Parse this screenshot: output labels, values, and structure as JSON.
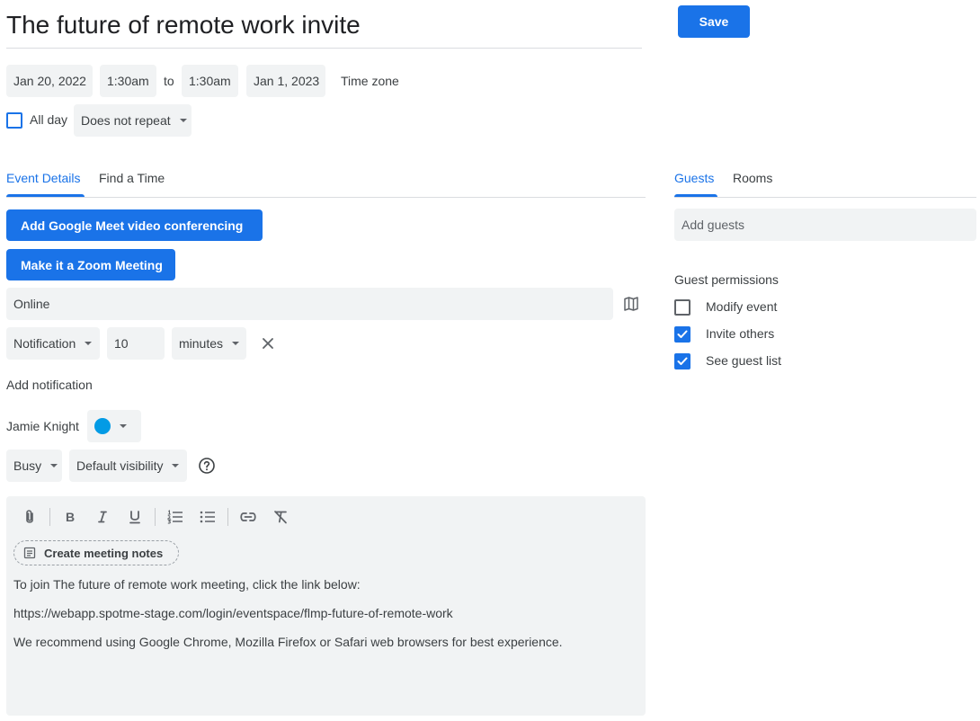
{
  "event": {
    "title": "The future of remote work invite",
    "save_label": "Save",
    "start_date": "Jan 20, 2022",
    "start_time": "1:30am",
    "to_label": "to",
    "end_time": "1:30am",
    "end_date": "Jan 1, 2023",
    "timezone_label": "Time zone",
    "all_day_label": "All day",
    "repeat_label": "Does not repeat"
  },
  "tabs": {
    "event_details": "Event Details",
    "find_time": "Find a Time",
    "guests": "Guests",
    "rooms": "Rooms"
  },
  "conferencing": {
    "meet_label": "Add Google Meet video conferencing",
    "zoom_label": "Make it a Zoom Meeting"
  },
  "location": {
    "value": "Online"
  },
  "notification": {
    "type": "Notification",
    "amount": "10",
    "unit": "minutes",
    "add_label": "Add notification"
  },
  "calendar": {
    "owner": "Jamie Knight",
    "color": "#039be5"
  },
  "status": {
    "availability": "Busy",
    "visibility": "Default visibility"
  },
  "description": {
    "notes_label": "Create meeting notes",
    "lines": [
      "To join The future of remote work meeting, click the link below:",
      "https://webapp.spotme-stage.com/login/eventspace/flmp-future-of-remote-work",
      "We recommend using Google Chrome, Mozilla Firefox or Safari web browsers for best experience."
    ]
  },
  "guests": {
    "placeholder": "Add guests",
    "permissions_title": "Guest permissions",
    "permissions": [
      {
        "label": "Modify event",
        "checked": false
      },
      {
        "label": "Invite others",
        "checked": true
      },
      {
        "label": "See guest list",
        "checked": true
      }
    ]
  },
  "colors": {
    "accent": "#1a73e8",
    "chip_bg": "#f1f3f4"
  }
}
